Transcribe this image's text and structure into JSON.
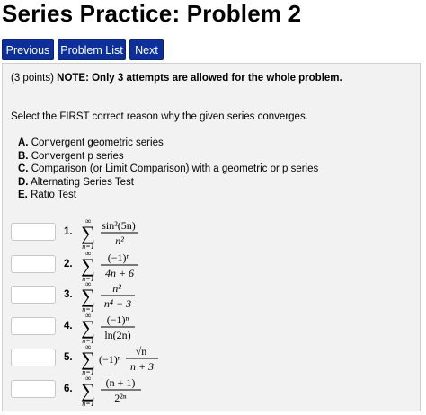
{
  "page": {
    "title": "Series Practice: Problem 2"
  },
  "nav": {
    "previous": "Previous",
    "problem_list": "Problem List",
    "next": "Next"
  },
  "problem": {
    "points": "(3 points)",
    "note": "NOTE: Only 3 attempts are allowed for the whole problem.",
    "prompt": "Select the FIRST correct reason why the given series converges.",
    "options": [
      {
        "letter": "A.",
        "text": "Convergent geometric series"
      },
      {
        "letter": "B.",
        "text": "Convergent p series"
      },
      {
        "letter": "C.",
        "text": "Comparison (or Limit Comparison) with a geometric or p series"
      },
      {
        "letter": "D.",
        "text": "Alternating Series Test"
      },
      {
        "letter": "E.",
        "text": "Ratio Test"
      }
    ],
    "items": [
      {
        "num": "1.",
        "value": "",
        "sum_top": "∞",
        "sum_bot": "n=1",
        "numerator": "sin²(5n)",
        "denominator": "n²"
      },
      {
        "num": "2.",
        "value": "",
        "sum_top": "∞",
        "sum_bot": "n=1",
        "numerator": "(−1)ⁿ",
        "denominator": "4n + 6"
      },
      {
        "num": "3.",
        "value": "",
        "sum_top": "∞",
        "sum_bot": "n=1",
        "numerator": "n²",
        "denominator": "n⁴ − 3"
      },
      {
        "num": "4.",
        "value": "",
        "sum_top": "∞",
        "sum_bot": "n=1",
        "numerator": "(−1)ⁿ",
        "denominator": "ln(2n)"
      },
      {
        "num": "5.",
        "value": "",
        "sum_top": "∞",
        "sum_bot": "n=1",
        "prefix": "(−1)ⁿ",
        "numerator": "√n",
        "denominator": "n + 3"
      },
      {
        "num": "6.",
        "value": "",
        "sum_top": "∞",
        "sum_bot": "n=1",
        "numerator": "(n + 1)",
        "denominator": "2²ⁿ"
      }
    ]
  }
}
